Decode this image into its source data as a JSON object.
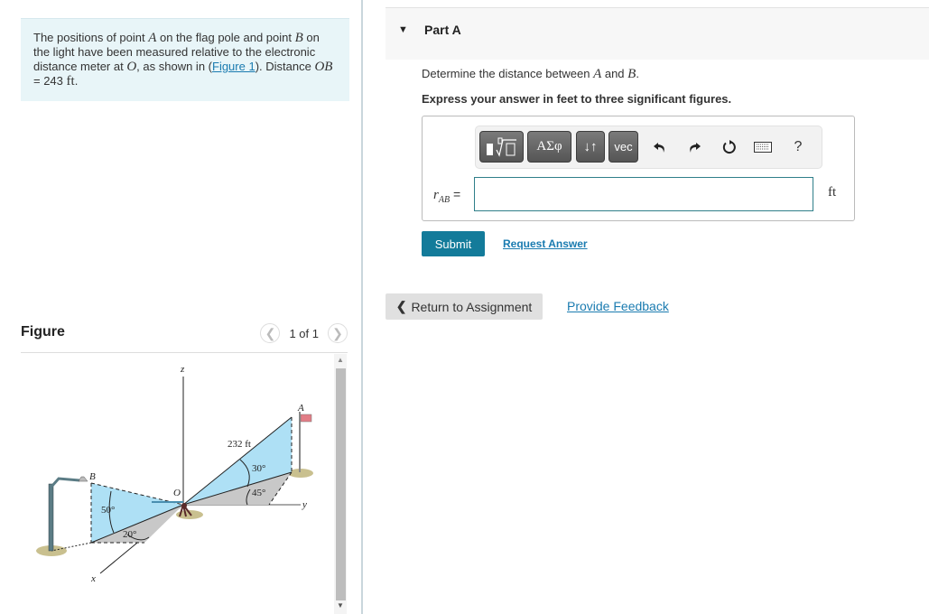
{
  "problem": {
    "intro_parts": {
      "t1": "The positions of point ",
      "A": "A",
      "t2": " on the flag pole and point ",
      "B": "B",
      "t3": " on the light have been measured relative to the electronic distance meter at ",
      "O": "O",
      "t4": ", as shown in (",
      "figure_link": "Figure 1",
      "t5": "). Distance ",
      "OB": "OB",
      "t6": " = 243 ",
      "unit": "ft",
      "t7": "."
    }
  },
  "figure": {
    "title": "Figure",
    "pager_text": "1 of 1",
    "prev_icon": "chevron-left-icon",
    "next_icon": "chevron-right-icon",
    "labels": {
      "z": "z",
      "x": "x",
      "y": "y",
      "A": "A",
      "B": "B",
      "O": "O",
      "dist": "232 ft",
      "ang50": "50°",
      "ang20": "20°",
      "ang30": "30°",
      "ang45": "45°"
    },
    "colors": {
      "plane_blue": "#aee0f5",
      "plane_gray": "#c8c8c8",
      "ground": "#c9c08f"
    }
  },
  "part": {
    "title": "Part A",
    "question_parts": {
      "t1": "Determine the distance between ",
      "A": "A",
      "t2": " and ",
      "B": "B",
      "t3": "."
    },
    "instruction": "Express your answer in feet to three significant figures.",
    "toolbar": {
      "templates_icon": "fraction-root-template-icon",
      "greek_label": "ΑΣφ",
      "arrows_label": "↓↑",
      "vec_label": "vec",
      "undo_icon": "undo-icon",
      "redo_icon": "redo-icon",
      "reset_icon": "reset-icon",
      "keyboard_icon": "keyboard-icon",
      "help_label": "?"
    },
    "variable": "r",
    "variable_sub": "AB",
    "equals": "=",
    "answer_value": "",
    "unit": "ft",
    "submit_label": "Submit",
    "request_label": "Request Answer"
  },
  "footer": {
    "return_label": "Return to Assignment",
    "feedback_label": "Provide Feedback"
  },
  "colors": {
    "accent": "#137b9a",
    "link": "#1a7bb0",
    "intro_bg": "#e8f5f8"
  }
}
